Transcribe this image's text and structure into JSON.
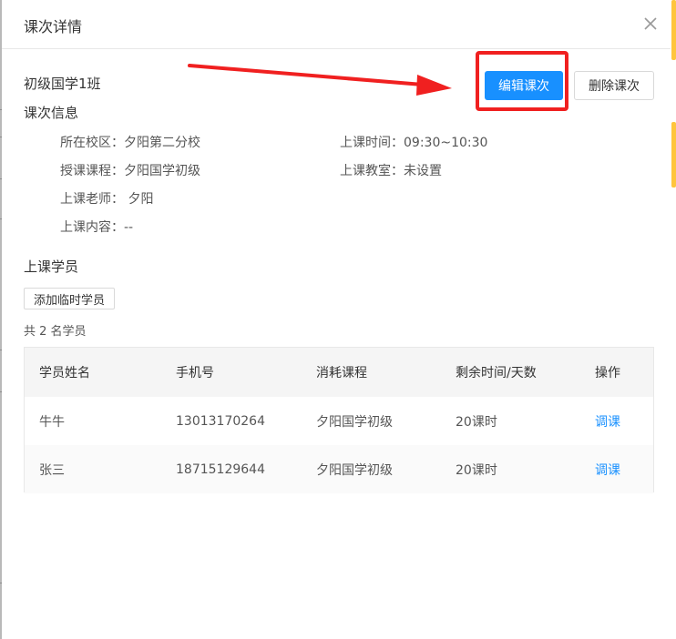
{
  "dialog": {
    "title": "课次详情",
    "class_name": "初级国学1班",
    "buttons": {
      "edit": "编辑课次",
      "delete": "删除课次"
    }
  },
  "info": {
    "section_title": "课次信息",
    "campus": "所在校区：夕阳第二分校",
    "course": "授课课程：夕阳国学初级",
    "teacher": "上课老师： 夕阳",
    "content": "上课内容：--",
    "time": "上课时间：09:30~10:30",
    "classroom": "上课教室：未设置"
  },
  "students": {
    "section_title": "上课学员",
    "add_button": "添加临时学员",
    "count_text": "共 2 名学员",
    "columns": [
      "学员姓名",
      "手机号",
      "消耗课程",
      "剩余时间/天数",
      "操作"
    ],
    "rows": [
      {
        "name": "牛牛",
        "phone": "13013170264",
        "course": "夕阳国学初级",
        "remaining": "20课时",
        "action": "调课"
      },
      {
        "name": "张三",
        "phone": "18715129644",
        "course": "夕阳国学初级",
        "remaining": "20课时",
        "action": "调课"
      }
    ]
  },
  "colors": {
    "primary": "#1890ff",
    "annotation_red": "#f02020",
    "accent_yellow": "#ffc53d"
  },
  "icons": {
    "close": "close-icon",
    "arrow": "red-arrow-annotation"
  }
}
